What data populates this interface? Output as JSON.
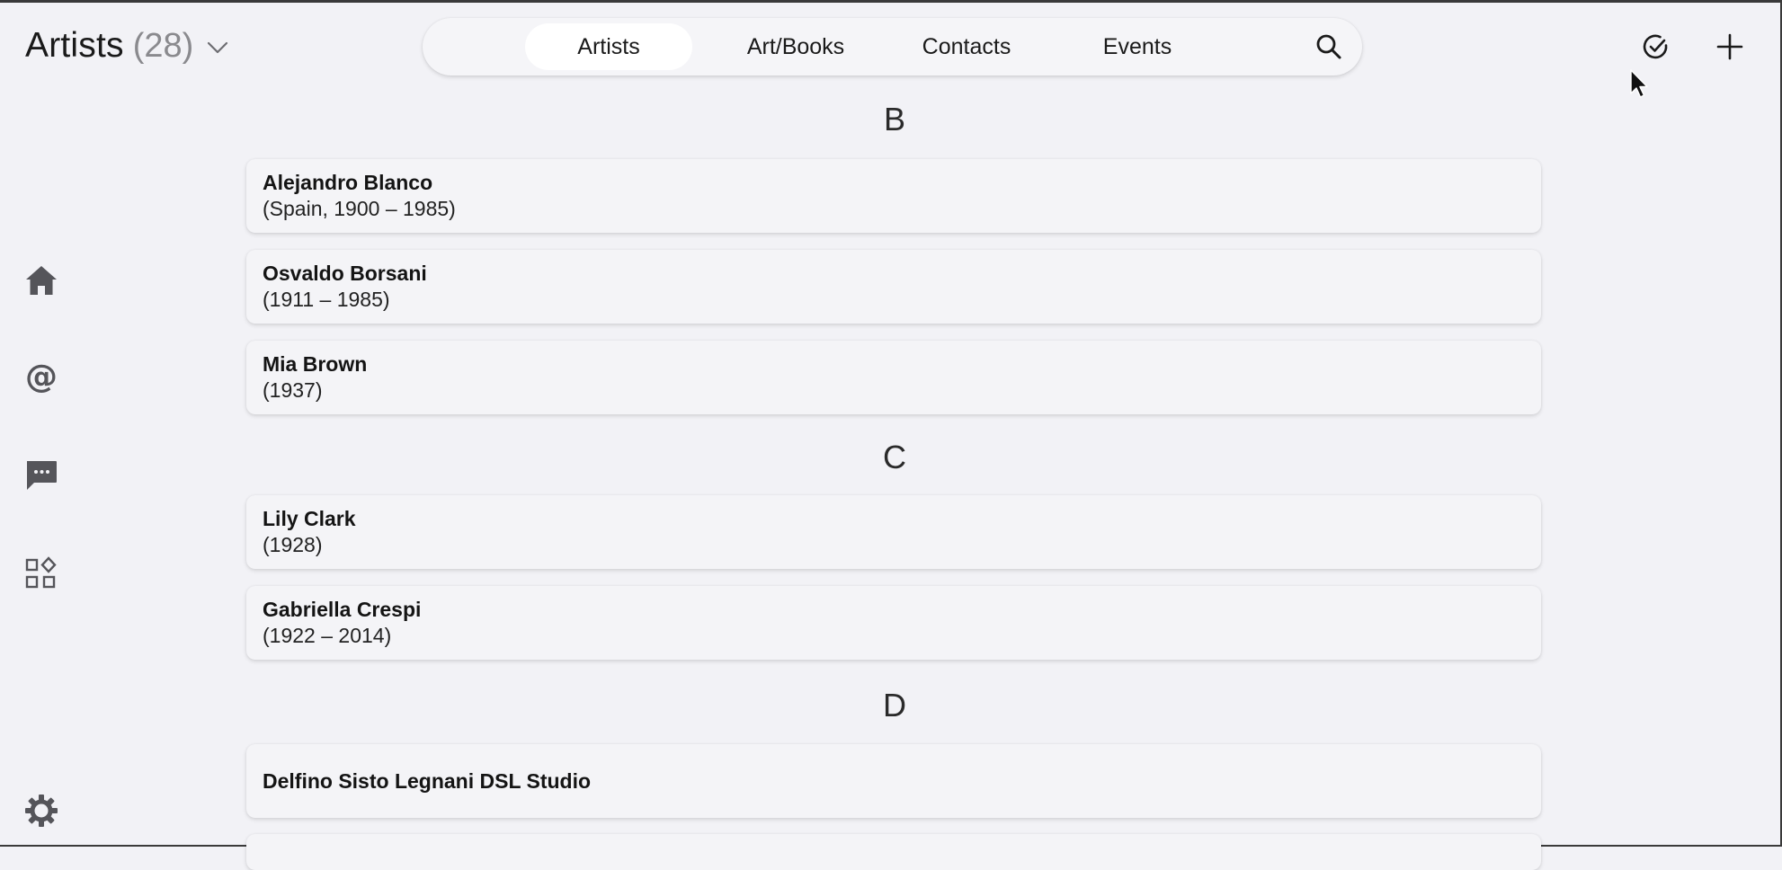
{
  "header": {
    "title": "Artists",
    "count": "(28)",
    "chevron_icon": "chevron-down-icon"
  },
  "tabs": [
    {
      "label": "Artists",
      "active": true
    },
    {
      "label": "Art/Books",
      "active": false
    },
    {
      "label": "Contacts",
      "active": false
    },
    {
      "label": "Events",
      "active": false
    }
  ],
  "toolbar": {
    "search_icon": "search-icon",
    "check_icon": "check-circle-icon",
    "add_icon": "plus-icon"
  },
  "sidebar": {
    "items": [
      {
        "icon": "home-icon"
      },
      {
        "icon": "at-sign-icon"
      },
      {
        "icon": "chat-icon"
      },
      {
        "icon": "apps-icon"
      },
      {
        "icon": "gear-icon"
      }
    ]
  },
  "sections": [
    {
      "letter": "B",
      "artists": [
        {
          "name": "Alejandro Blanco",
          "dates": "(Spain, 1900 – 1985)"
        },
        {
          "name": "Osvaldo Borsani",
          "dates": "(1911 – 1985)"
        },
        {
          "name": "Mia Brown",
          "dates": "(1937)"
        }
      ]
    },
    {
      "letter": "C",
      "artists": [
        {
          "name": "Lily Clark",
          "dates": "(1928)"
        },
        {
          "name": "Gabriella Crespi",
          "dates": "(1922 – 2014)"
        }
      ]
    },
    {
      "letter": "D",
      "artists": [
        {
          "name": "Delfino Sisto Legnani DSL Studio",
          "dates": ""
        }
      ]
    }
  ],
  "colors": {
    "background": "#f2f2f6",
    "card": "#f4f4f7",
    "icon_gray": "#5a5a5e",
    "text": "#1a1a1a",
    "muted": "#8a8a8e"
  }
}
